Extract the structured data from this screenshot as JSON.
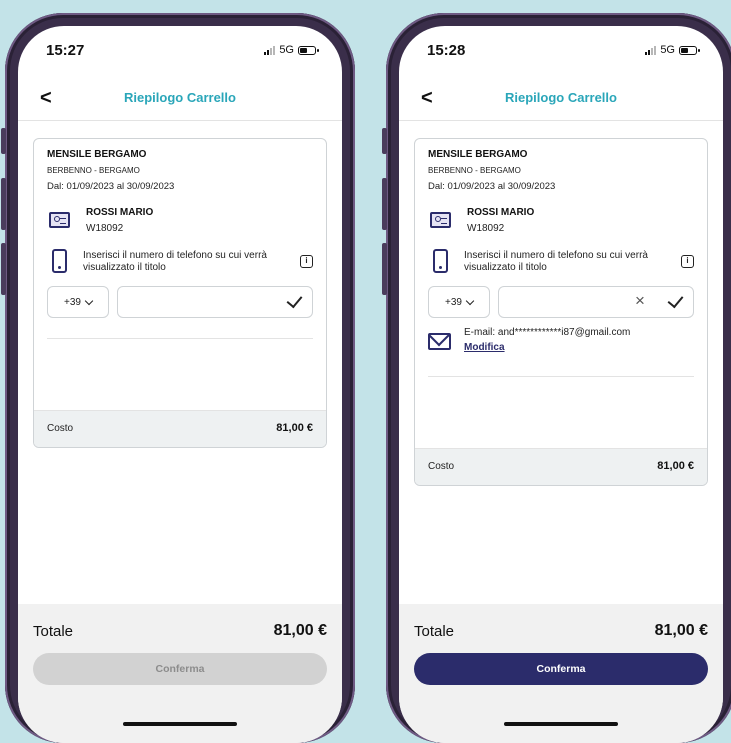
{
  "screens": [
    {
      "status": {
        "time": "15:27",
        "network": "5G"
      },
      "header": {
        "back_label": "<",
        "title": "Riepilogo Carrello"
      },
      "card": {
        "title": "MENSILE BERGAMO",
        "subtitle": "BERBENNO - BERGAMO",
        "dates": "Dal: 01/09/2023 al 30/09/2023",
        "person_name": "ROSSI MARIO",
        "person_code": "W18092",
        "phone_prompt": "Inserisci il numero di telefono su cui verrà visualizzato il titolo",
        "info_icon": "i",
        "prefix": "+39",
        "phone_value": "",
        "cost_label": "Costo",
        "cost_value": "81,00 €"
      },
      "footer": {
        "total_label": "Totale",
        "total_value": "81,00 €",
        "confirm_label": "Conferma",
        "confirm_enabled": false
      }
    },
    {
      "status": {
        "time": "15:28",
        "network": "5G"
      },
      "header": {
        "back_label": "<",
        "title": "Riepilogo Carrello"
      },
      "card": {
        "title": "MENSILE BERGAMO",
        "subtitle": "BERBENNO - BERGAMO",
        "dates": "Dal: 01/09/2023 al 30/09/2023",
        "person_name": "ROSSI MARIO",
        "person_code": "W18092",
        "phone_prompt": "Inserisci il numero di telefono su cui verrà visualizzato il titolo",
        "info_icon": "i",
        "prefix": "+39",
        "phone_value": "",
        "clear_icon": "×",
        "email_text": "E-mail: and************i87@gmail.com",
        "modify_label": "Modifica",
        "cost_label": "Costo",
        "cost_value": "81,00 €"
      },
      "footer": {
        "total_label": "Totale",
        "total_value": "81,00 €",
        "confirm_label": "Conferma",
        "confirm_enabled": true
      }
    }
  ],
  "colors": {
    "accent_title": "#2aa6b9",
    "primary": "#2b2c6b",
    "background": "#c3e3e8",
    "disabled_button": "#d2d2d2"
  },
  "icons": [
    "back-chevron-icon",
    "id-card-icon",
    "smartphone-icon",
    "info-icon",
    "chevron-down-icon",
    "checkmark-icon",
    "clear-icon",
    "envelope-icon",
    "signal-icon",
    "battery-icon"
  ]
}
